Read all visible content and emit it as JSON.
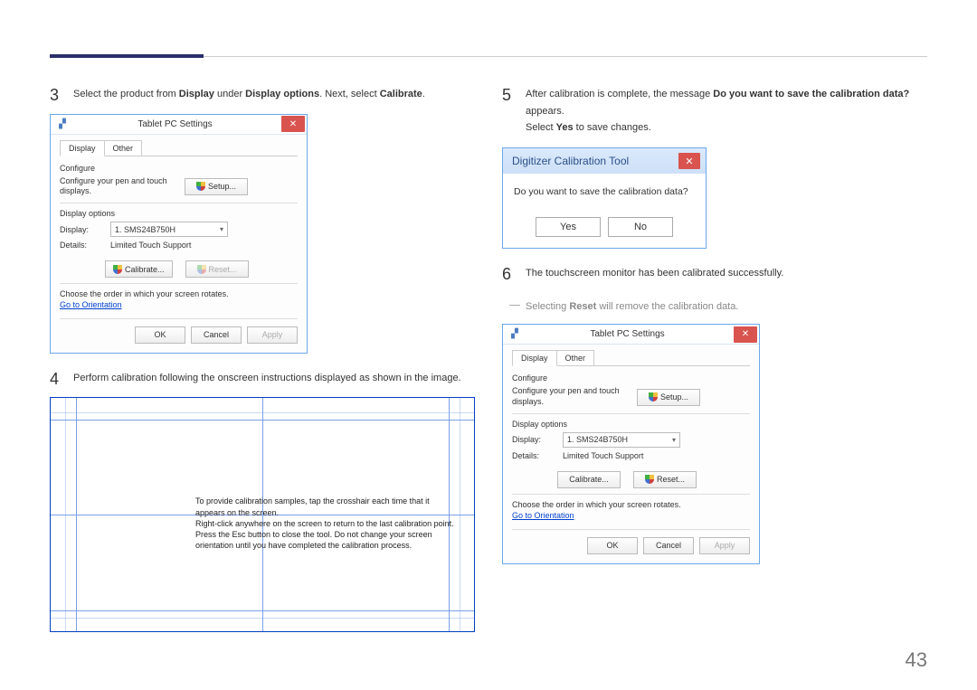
{
  "page_number": "43",
  "step3": {
    "num": "3",
    "text_parts": [
      "Select the product from ",
      "Display",
      " under ",
      "Display options",
      ". Next, select ",
      "Calibrate",
      "."
    ]
  },
  "step4": {
    "num": "4",
    "text": "Perform calibration following the onscreen instructions displayed as shown in the image."
  },
  "step5": {
    "num": "5",
    "line1_parts": [
      "After calibration is complete, the message ",
      "Do you want to save the calibration data?",
      " appears."
    ],
    "line2_parts": [
      "Select ",
      "Yes",
      " to save changes."
    ]
  },
  "step6": {
    "num": "6",
    "text": "The touchscreen monitor has been calibrated successfully."
  },
  "note": {
    "parts": [
      "Selecting ",
      "Reset",
      " will remove the calibration data."
    ]
  },
  "tablet_win": {
    "title": "Tablet PC Settings",
    "tabs": {
      "display": "Display",
      "other": "Other"
    },
    "configure_label": "Configure",
    "configure_text": "Configure your pen and touch displays.",
    "setup_btn": "Setup...",
    "display_options_label": "Display options",
    "display_label": "Display:",
    "display_value": "1. SMS24B750H",
    "details_label": "Details:",
    "details_value": "Limited Touch Support",
    "calibrate_btn": "Calibrate...",
    "reset_btn": "Reset...",
    "orientation_text": "Choose the order in which your screen rotates.",
    "orientation_link": "Go to Orientation",
    "ok_btn": "OK",
    "cancel_btn": "Cancel",
    "apply_btn": "Apply"
  },
  "calib_msg": "To provide calibration samples, tap the crosshair each time that it appears on the screen.\nRight-click anywhere on the screen to return to the last calibration point. Press the Esc button to close the tool. Do not change your screen orientation until you have completed the calibration process.",
  "digitizer": {
    "title": "Digitizer Calibration Tool",
    "question": "Do you want to save the calibration data?",
    "yes": "Yes",
    "no": "No"
  }
}
